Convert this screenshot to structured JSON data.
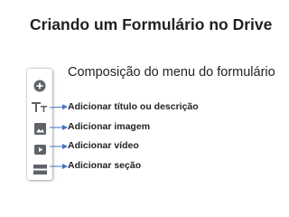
{
  "slide": {
    "title": "Criando um Formulário no Drive",
    "subtitle": "Composição do menu do formulário"
  },
  "toolbar": {
    "tools": [
      {
        "icon": "add-circle-icon"
      },
      {
        "icon": "text-format-icon",
        "label": "Adicionar título ou descrição"
      },
      {
        "icon": "image-icon",
        "label": "Adicionar imagem"
      },
      {
        "icon": "video-icon",
        "label": "Adicionar vídeo"
      },
      {
        "icon": "section-icon",
        "label": "Adicionar seção"
      }
    ]
  },
  "colors": {
    "icon": "#5f6368",
    "arrow": "#4472c4",
    "text": "#222222"
  }
}
